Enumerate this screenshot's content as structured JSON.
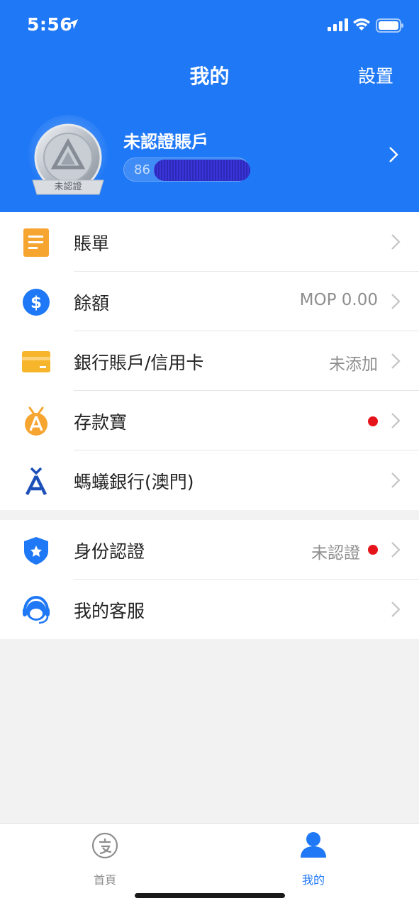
{
  "status_bar": {
    "time": "5:56"
  },
  "header": {
    "title": "我的",
    "settings_label": "設置",
    "background_color": "#1f78f5"
  },
  "profile": {
    "badge_label": "未認證",
    "name": "未認證賬戶",
    "phone_prefix": "86"
  },
  "menu": {
    "group1": [
      {
        "label": "賬單",
        "value": "",
        "icon": "bill-icon"
      },
      {
        "label": "餘額",
        "value": "MOP 0.00",
        "icon": "dollar-icon"
      },
      {
        "label": "銀行賬戶/信用卡",
        "value": "未添加",
        "icon": "card-icon"
      },
      {
        "label": "存款寶",
        "value": "",
        "icon": "savings-icon",
        "dot": true
      },
      {
        "label": "螞蟻銀行(澳門)",
        "value": "",
        "icon": "ant-bank-icon"
      }
    ],
    "group2": [
      {
        "label": "身份認證",
        "value": "未認證",
        "icon": "shield-icon",
        "dot": true
      },
      {
        "label": "我的客服",
        "value": "",
        "icon": "customer-service-icon"
      }
    ]
  },
  "tabbar": {
    "home_label": "首頁",
    "mine_label": "我的",
    "active_color": "#1f78f5",
    "inactive_color": "#8e8e8e"
  }
}
